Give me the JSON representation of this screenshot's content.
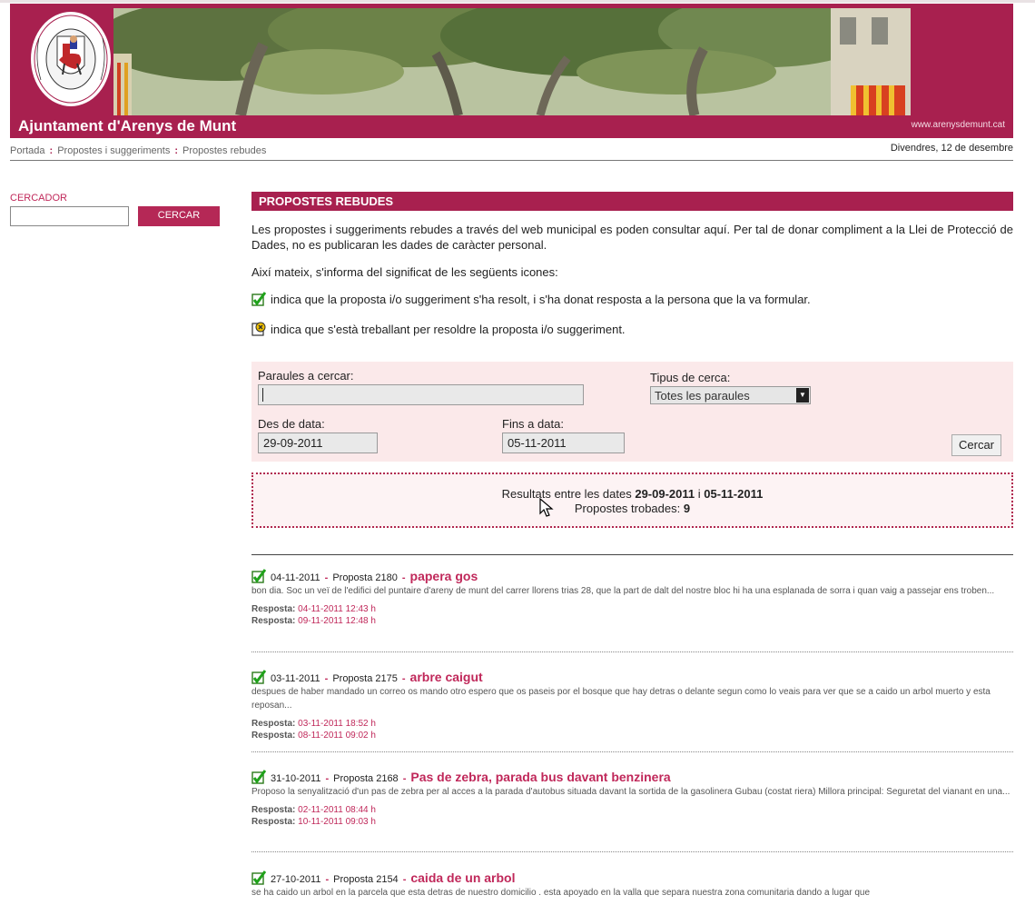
{
  "header": {
    "site_title": "Ajuntament d'Arenys de Munt",
    "site_url": "www.arenysdemunt.cat",
    "logo_text": "AJUNTAMENT ARENYS DE MUNT"
  },
  "breadcrumb": {
    "items": [
      "Portada",
      "Propostes i suggeriments",
      "Propostes rebudes"
    ],
    "separator": ":"
  },
  "date_top": "Divendres, 12 de desembre",
  "sidebar": {
    "search_label": "CERCADOR",
    "search_value": "",
    "search_button": "CERCAR"
  },
  "main": {
    "title": "PROPOSTES REBUDES",
    "intro": "Les propostes i suggeriments rebudes a través del web municipal es poden consultar aquí. Per tal de donar compliment a la Llei de Protecció de Dades, no es publicaran les dades de caràcter personal.",
    "icons_intro": "Així mateix, s'informa del significat de les següents icones:",
    "legend_resolved": "indica que la proposta i/o suggeriment s'ha resolt, i s'ha donat resposta a la persona que la va formular.",
    "legend_working": "indica que s'està treballant per resoldre la proposta i/o suggeriment."
  },
  "filter": {
    "words_label": "Paraules a cercar:",
    "words_value": "",
    "type_label": "Tipus de cerca:",
    "type_selected": "Totes les paraules",
    "from_label": "Des de data:",
    "from_value": "29-09-2011",
    "to_label": "Fins a data:",
    "to_value": "05-11-2011",
    "button": "Cercar"
  },
  "results": {
    "prefix": "Resultats entre les dates",
    "date_from": "29-09-2011",
    "joiner": "i",
    "date_to": "05-11-2011",
    "found_label": "Propostes trobades:",
    "found_count": "9"
  },
  "colors": {
    "brand": "#a8204f",
    "accent_text": "#c0285a",
    "filter_bg": "#fbe9ea"
  },
  "proposals": [
    {
      "date": "04-11-2011",
      "number": "Proposta 2180",
      "title": "papera gos",
      "body": "bon dia. Soc un veï de l'edifici del puntaire d'areny de munt del carrer llorens trias 28, que la part de dalt del nostre bloc hi ha una esplanada de sorra i quan vaig a passejar ens troben...",
      "resp_label": "Resposta:",
      "resp1": "04-11-2011 12:43 h",
      "resp2": "09-11-2011 12:48 h"
    },
    {
      "date": "03-11-2011",
      "number": "Proposta 2175",
      "title": "arbre caigut",
      "body": "despues de haber mandado un correo os mando otro  espero que os paseis por el bosque que hay detras o delante segun como lo veais para ver que se a caido un arbol muerto y esta reposan...",
      "resp_label": "Resposta:",
      "resp1": "03-11-2011 18:52 h",
      "resp2": "08-11-2011 09:02 h"
    },
    {
      "date": "31-10-2011",
      "number": "Proposta 2168",
      "title": "Pas de zebra, parada bus davant benzinera",
      "body": "Proposo la senyalització d'un pas de zebra per al acces a la parada d'autobus situada davant la sortida de la gasolinera Gubau (costat riera) Millora principal: Seguretat del vianant en una...",
      "resp_label": "Resposta:",
      "resp1": "02-11-2011 08:44 h",
      "resp2": "10-11-2011 09:03 h"
    },
    {
      "date": "27-10-2011",
      "number": "Proposta 2154",
      "title": "caida  de un arbol",
      "body": "se ha caido un arbol en la parcela que esta detras de nuestro domicilio . esta apoyado en la valla que separa nuestra zona comunitaria dando a lugar que"
    }
  ]
}
